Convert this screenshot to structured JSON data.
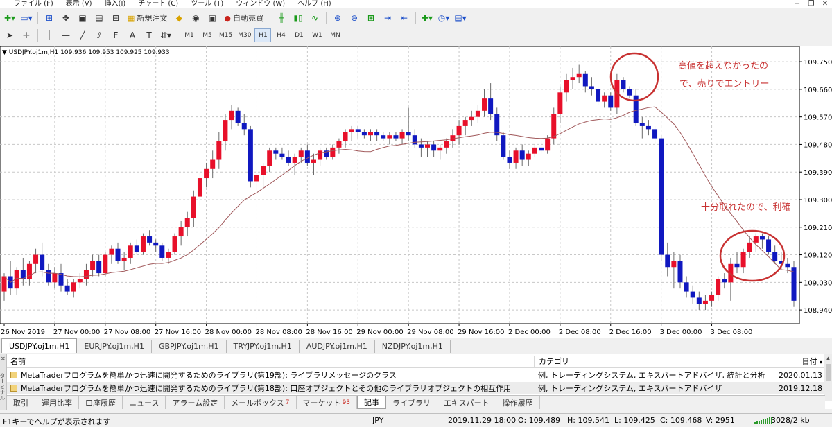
{
  "menu": {
    "items": [
      "ファイル (F)",
      "表示 (V)",
      "挿入(I)",
      "チャート (C)",
      "ツール (T)",
      "ウィンドウ (W)",
      "ヘルプ (H)"
    ]
  },
  "toolbar": {
    "new_order_label": "新規注文",
    "auto_trade_label": "自動売買",
    "timeframes": [
      "M1",
      "M5",
      "M15",
      "M30",
      "H1",
      "H4",
      "D1",
      "W1",
      "MN"
    ],
    "active_timeframe": "H1",
    "colors": {
      "auto_trade_icon": "#c9231c",
      "new_order_icon": "#d9a300"
    }
  },
  "chart": {
    "info_line": "USDJPY.oj1m,H1  109.936 109.953 109.925 109.933",
    "price_labels": [
      "109.750",
      "109.660",
      "109.570",
      "109.480",
      "109.390",
      "109.300",
      "109.210",
      "109.120",
      "109.030",
      "108.940"
    ],
    "current_price": "109.933",
    "time_labels": [
      "26 Nov 2019",
      "27 Nov 00:00",
      "27 Nov 08:00",
      "27 Nov 16:00",
      "28 Nov 00:00",
      "28 Nov 08:00",
      "28 Nov 16:00",
      "29 Nov 00:00",
      "29 Nov 08:00",
      "29 Nov 16:00",
      "2 Dec 00:00",
      "2 Dec 08:00",
      "2 Dec 16:00",
      "3 Dec 00:00",
      "3 Dec 08:00"
    ],
    "annotation_top_1": "高値を超えなかったの",
    "annotation_top_2": "で、売りでエントリー",
    "annotation_bottom": "十分取れたので、利確",
    "colors": {
      "bull": "#e8102a",
      "bear": "#1018c0",
      "ma": "#a0585a",
      "annotation": "#c83232",
      "grid": "#c8c8c8"
    }
  },
  "chart_tabs": {
    "items": [
      "USDJPY.oj1m,H1",
      "EURJPY.oj1m,H1",
      "GBPJPY.oj1m,H1",
      "TRYJPY.oj1m,H1",
      "AUDJPY.oj1m,H1",
      "NZDJPY.oj1m,H1"
    ],
    "active": 0
  },
  "terminal": {
    "headers": {
      "name": "名前",
      "category": "カテゴリ",
      "date": "日付"
    },
    "rows": [
      {
        "name": "MetaTraderプログラムを簡単かつ迅速に開発するためのライブラリ(第19部): ライブラリメッセージのクラス",
        "category": "例, トレーディングシステム, エキスパートアドバイザ, 統計と分析",
        "date": "2020.01.13"
      },
      {
        "name": "MetaTraderプログラムを簡単かつ迅速に開発するためのライブラリ(第18部): 口座オブジェクトとその他のライブラリオブジェクトの相互作用",
        "category": "例, トレーディングシステム, エキスパートアドバイザ",
        "date": "2019.12.18"
      }
    ],
    "tabs": [
      "取引",
      "運用比率",
      "口座履歴",
      "ニュース",
      "アラーム設定",
      "メールボックス",
      "マーケット",
      "記事",
      "ライブラリ",
      "エキスパート",
      "操作履歴"
    ],
    "mailbox_badge": "7",
    "market_badge": "93",
    "active_tab": "記事",
    "side_label": "ターミナル"
  },
  "status": {
    "help": "F1キーでヘルプが表示されます",
    "currency": "JPY",
    "datetime": "2019.11.29 18:00",
    "open": "O: 109.489",
    "high": "H: 109.541",
    "low": "L: 109.425",
    "close": "C: 109.468",
    "volume": "V: 2951",
    "traffic": "3028/2 kb"
  },
  "chart_data": {
    "type": "candlestick",
    "symbol": "USDJPY.oj1m",
    "timeframe": "H1",
    "ylim": [
      108.895,
      109.8
    ],
    "candles": [
      [
        109.0,
        109.06,
        108.97,
        109.05
      ],
      [
        109.05,
        109.1,
        108.99,
        109.01
      ],
      [
        109.01,
        109.08,
        108.99,
        109.07
      ],
      [
        109.07,
        109.11,
        109.02,
        109.04
      ],
      [
        109.04,
        109.1,
        109.02,
        109.09
      ],
      [
        109.09,
        109.14,
        109.06,
        109.12
      ],
      [
        109.12,
        109.16,
        109.05,
        109.07
      ],
      [
        109.07,
        109.09,
        109.02,
        109.03
      ],
      [
        109.03,
        109.08,
        109.01,
        109.06
      ],
      [
        109.06,
        109.09,
        109.0,
        109.02
      ],
      [
        109.02,
        109.04,
        108.99,
        109.0
      ],
      [
        109.0,
        109.04,
        108.98,
        109.03
      ],
      [
        109.03,
        109.06,
        109.01,
        109.04
      ],
      [
        109.04,
        109.09,
        109.02,
        109.07
      ],
      [
        109.07,
        109.12,
        109.05,
        109.1
      ],
      [
        109.1,
        109.12,
        109.05,
        109.06
      ],
      [
        109.06,
        109.13,
        109.05,
        109.12
      ],
      [
        109.12,
        109.15,
        109.09,
        109.14
      ],
      [
        109.14,
        109.16,
        109.09,
        109.1
      ],
      [
        109.1,
        109.13,
        109.07,
        109.11
      ],
      [
        109.11,
        109.16,
        109.09,
        109.15
      ],
      [
        109.15,
        109.17,
        109.12,
        109.13
      ],
      [
        109.13,
        109.19,
        109.12,
        109.18
      ],
      [
        109.18,
        109.2,
        109.15,
        109.16
      ],
      [
        109.16,
        109.17,
        109.13,
        109.15
      ],
      [
        109.15,
        109.16,
        109.1,
        109.11
      ],
      [
        109.11,
        109.14,
        109.09,
        109.13
      ],
      [
        109.13,
        109.19,
        109.12,
        109.18
      ],
      [
        109.18,
        109.23,
        109.15,
        109.21
      ],
      [
        109.21,
        109.26,
        109.18,
        109.24
      ],
      [
        109.24,
        109.33,
        109.21,
        109.31
      ],
      [
        109.31,
        109.39,
        109.28,
        109.37
      ],
      [
        109.37,
        109.42,
        109.34,
        109.4
      ],
      [
        109.4,
        109.46,
        109.37,
        109.43
      ],
      [
        109.43,
        109.52,
        109.4,
        109.49
      ],
      [
        109.49,
        109.58,
        109.46,
        109.56
      ],
      [
        109.56,
        109.61,
        109.53,
        109.59
      ],
      [
        109.59,
        109.6,
        109.54,
        109.55
      ],
      [
        109.55,
        109.58,
        109.51,
        109.53
      ],
      [
        109.53,
        109.54,
        109.34,
        109.36
      ],
      [
        109.36,
        109.4,
        109.33,
        109.38
      ],
      [
        109.38,
        109.42,
        109.34,
        109.41
      ],
      [
        109.41,
        109.47,
        109.39,
        109.46
      ],
      [
        109.46,
        109.47,
        109.43,
        109.45
      ],
      [
        109.45,
        109.47,
        109.43,
        109.44
      ],
      [
        109.44,
        109.46,
        109.41,
        109.42
      ],
      [
        109.42,
        109.45,
        109.38,
        109.44
      ],
      [
        109.44,
        109.47,
        109.42,
        109.46
      ],
      [
        109.46,
        109.48,
        109.41,
        109.42
      ],
      [
        109.42,
        109.45,
        109.38,
        109.43
      ],
      [
        109.43,
        109.47,
        109.41,
        109.46
      ],
      [
        109.46,
        109.47,
        109.43,
        109.44
      ],
      [
        109.44,
        109.48,
        109.43,
        109.47
      ],
      [
        109.47,
        109.5,
        109.45,
        109.49
      ],
      [
        109.49,
        109.53,
        109.47,
        109.52
      ],
      [
        109.52,
        109.54,
        109.49,
        109.53
      ],
      [
        109.53,
        109.54,
        109.5,
        109.52
      ],
      [
        109.52,
        109.53,
        109.5,
        109.51
      ],
      [
        109.51,
        109.53,
        109.49,
        109.52
      ],
      [
        109.52,
        109.53,
        109.49,
        109.51
      ],
      [
        109.51,
        109.52,
        109.49,
        109.5
      ],
      [
        109.5,
        109.52,
        109.48,
        109.51
      ],
      [
        109.51,
        109.52,
        109.49,
        109.5
      ],
      [
        109.5,
        109.53,
        109.48,
        109.52
      ],
      [
        109.52,
        109.6,
        109.49,
        109.51
      ],
      [
        109.51,
        109.53,
        109.47,
        109.48
      ],
      [
        109.48,
        109.5,
        109.44,
        109.47
      ],
      [
        109.47,
        109.49,
        109.44,
        109.48
      ],
      [
        109.48,
        109.49,
        109.44,
        109.46
      ],
      [
        109.46,
        109.48,
        109.43,
        109.47
      ],
      [
        109.47,
        109.5,
        109.45,
        109.49
      ],
      [
        109.49,
        109.53,
        109.47,
        109.51
      ],
      [
        109.51,
        109.56,
        109.48,
        109.54
      ],
      [
        109.54,
        109.57,
        109.51,
        109.56
      ],
      [
        109.56,
        109.59,
        109.54,
        109.57
      ],
      [
        109.57,
        109.61,
        109.55,
        109.59
      ],
      [
        109.59,
        109.66,
        109.57,
        109.63
      ],
      [
        109.63,
        109.68,
        109.56,
        109.58
      ],
      [
        109.58,
        109.6,
        109.49,
        109.51
      ],
      [
        109.51,
        109.52,
        109.43,
        109.44
      ],
      [
        109.44,
        109.46,
        109.4,
        109.42
      ],
      [
        109.42,
        109.47,
        109.4,
        109.46
      ],
      [
        109.46,
        109.48,
        109.41,
        109.43
      ],
      [
        109.43,
        109.46,
        109.41,
        109.45
      ],
      [
        109.45,
        109.48,
        109.44,
        109.47
      ],
      [
        109.47,
        109.49,
        109.45,
        109.46
      ],
      [
        109.46,
        109.51,
        109.45,
        109.5
      ],
      [
        109.5,
        109.6,
        109.48,
        109.58
      ],
      [
        109.58,
        109.67,
        109.55,
        109.65
      ],
      [
        109.65,
        109.71,
        109.62,
        109.69
      ],
      [
        109.69,
        109.73,
        109.66,
        109.7
      ],
      [
        109.7,
        109.74,
        109.68,
        109.71
      ],
      [
        109.71,
        109.72,
        109.65,
        109.67
      ],
      [
        109.67,
        109.7,
        109.64,
        109.66
      ],
      [
        109.66,
        109.67,
        109.61,
        109.62
      ],
      [
        109.62,
        109.65,
        109.6,
        109.64
      ],
      [
        109.64,
        109.65,
        109.59,
        109.6
      ],
      [
        109.6,
        109.71,
        109.58,
        109.69
      ],
      [
        109.69,
        109.7,
        109.65,
        109.66
      ],
      [
        109.66,
        109.67,
        109.63,
        109.64
      ],
      [
        109.64,
        109.66,
        109.54,
        109.55
      ],
      [
        109.55,
        109.57,
        109.5,
        109.54
      ],
      [
        109.54,
        109.56,
        109.51,
        109.53
      ],
      [
        109.53,
        109.54,
        109.48,
        109.5
      ],
      [
        109.5,
        109.51,
        109.1,
        109.12
      ],
      [
        109.12,
        109.16,
        109.05,
        109.08
      ],
      [
        109.08,
        109.13,
        109.01,
        109.1
      ],
      [
        109.1,
        109.12,
        109.01,
        109.03
      ],
      [
        109.03,
        109.05,
        108.98,
        109.0
      ],
      [
        109.0,
        109.02,
        108.96,
        108.98
      ],
      [
        108.98,
        109.0,
        108.94,
        108.96
      ],
      [
        108.96,
        108.99,
        108.94,
        108.97
      ],
      [
        108.97,
        109.0,
        108.95,
        108.99
      ],
      [
        108.99,
        109.05,
        108.97,
        109.04
      ],
      [
        109.04,
        109.06,
        109.01,
        109.03
      ],
      [
        109.03,
        109.11,
        108.97,
        109.09
      ],
      [
        109.09,
        109.13,
        109.06,
        109.08
      ],
      [
        109.08,
        109.14,
        109.06,
        109.13
      ],
      [
        109.13,
        109.18,
        109.11,
        109.16
      ],
      [
        109.16,
        109.19,
        109.13,
        109.18
      ],
      [
        109.18,
        109.19,
        109.14,
        109.17
      ],
      [
        109.17,
        109.18,
        109.12,
        109.13
      ],
      [
        109.13,
        109.15,
        109.09,
        109.1
      ],
      [
        109.1,
        109.13,
        109.07,
        109.09
      ],
      [
        109.09,
        109.11,
        109.06,
        109.08
      ],
      [
        109.08,
        109.1,
        108.95,
        108.97
      ]
    ]
  }
}
